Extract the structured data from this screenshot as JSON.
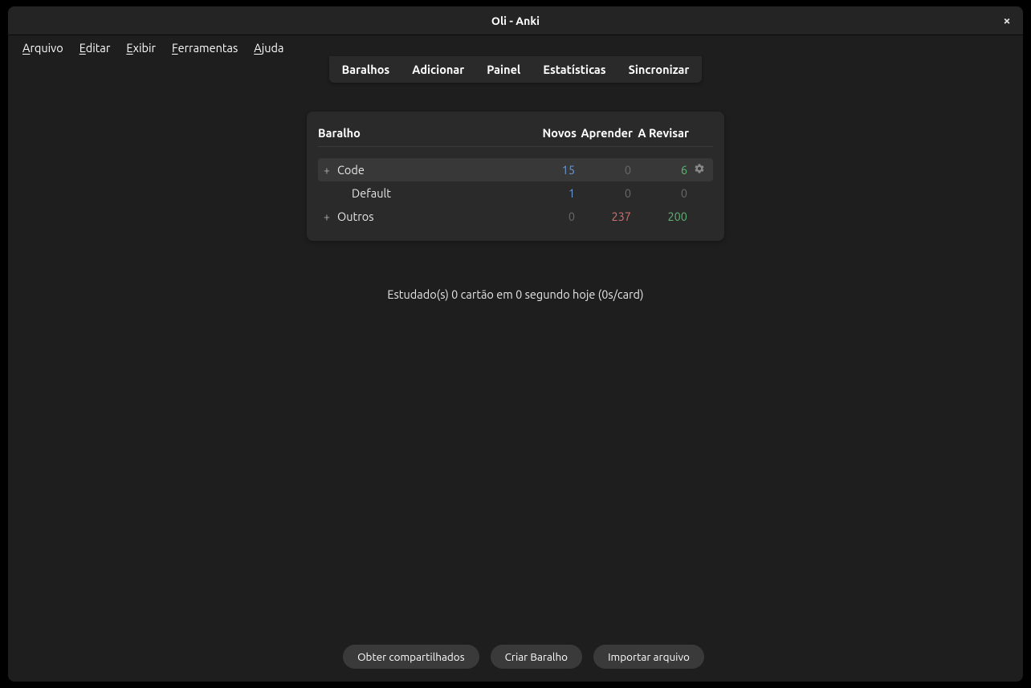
{
  "window": {
    "title": "Oli - Anki"
  },
  "menubar": {
    "items": [
      {
        "accel": "A",
        "rest": "rquivo"
      },
      {
        "accel": "E",
        "rest": "ditar"
      },
      {
        "accel": "E",
        "rest": "xibir"
      },
      {
        "accel": "F",
        "rest": "erramentas"
      },
      {
        "accel": "A",
        "rest": "juda"
      }
    ]
  },
  "toolbar": {
    "decks": "Baralhos",
    "add": "Adicionar",
    "browse": "Painel",
    "stats": "Estatísticas",
    "sync": "Sincronizar"
  },
  "deck_table": {
    "headers": {
      "deck": "Baralho",
      "new": "Novos",
      "learn": "Aprender",
      "due": "A Revisar"
    },
    "rows": [
      {
        "expand": "+",
        "name": "Code",
        "indent": false,
        "new": "15",
        "new_cls": "num-new",
        "learn": "0",
        "learn_cls": "num-learn-zero",
        "due": "6",
        "due_cls": "num-due",
        "highlighted": true,
        "show_gear": true
      },
      {
        "expand": "",
        "name": "Default",
        "indent": true,
        "new": "1",
        "new_cls": "num-new",
        "learn": "0",
        "learn_cls": "num-learn-zero",
        "due": "0",
        "due_cls": "num-due-zero",
        "highlighted": false,
        "show_gear": false
      },
      {
        "expand": "+",
        "name": "Outros",
        "indent": false,
        "new": "0",
        "new_cls": "num-zero",
        "learn": "237",
        "learn_cls": "num-learn",
        "due": "200",
        "due_cls": "num-due",
        "highlighted": false,
        "show_gear": false
      }
    ]
  },
  "status": {
    "studied": "Estudado(s) 0 cartão em 0 segundo hoje (0s/card)"
  },
  "bottombar": {
    "get_shared": "Obter compartilhados",
    "create_deck": "Criar Baralho",
    "import_file": "Importar arquivo"
  }
}
